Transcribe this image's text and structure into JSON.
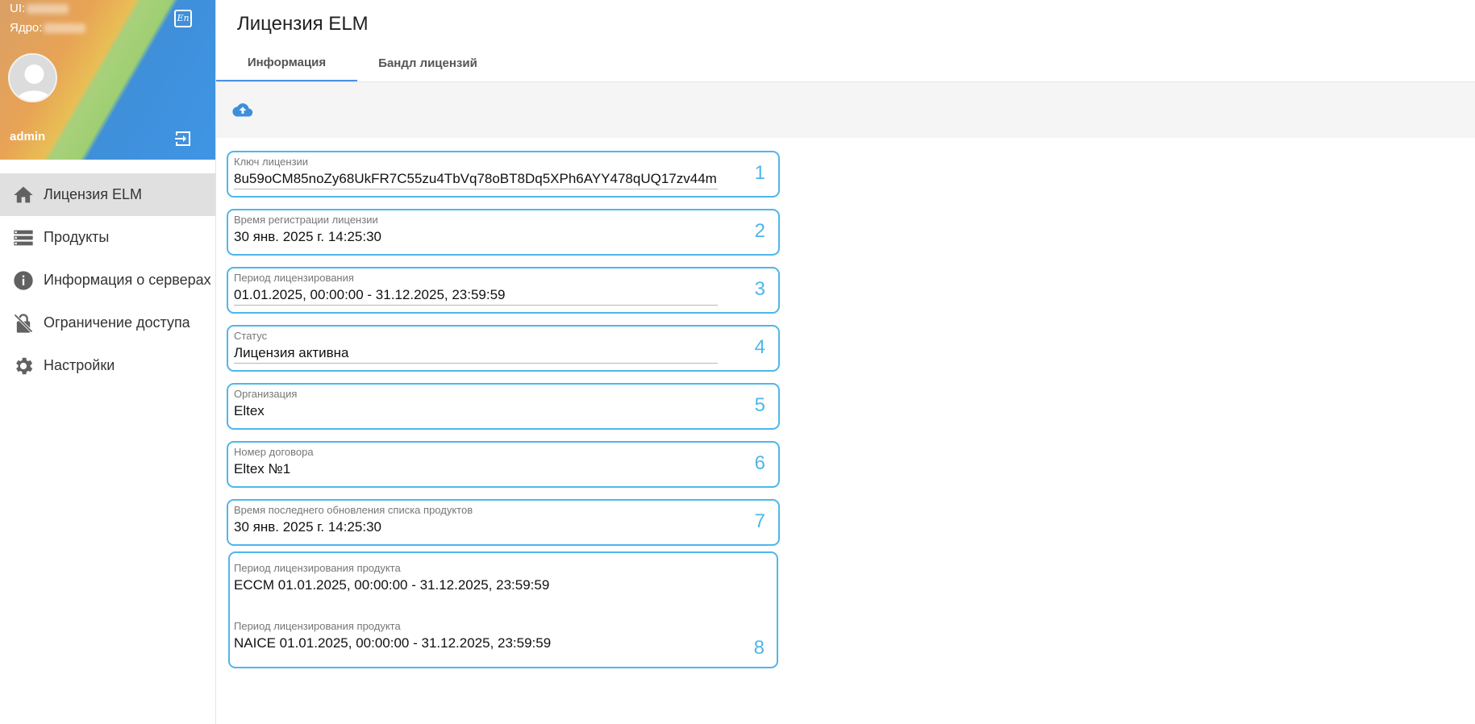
{
  "sidebar": {
    "ui_label": "UI:",
    "core_label": "Ядро:",
    "lang_icon_text": "En",
    "username": "admin",
    "items": [
      {
        "label": "Лицензия ELM",
        "icon": "home-icon",
        "active": true
      },
      {
        "label": "Продукты",
        "icon": "list-icon",
        "active": false
      },
      {
        "label": "Информация о серверах",
        "icon": "info-icon",
        "active": false
      },
      {
        "label": "Ограничение доступа",
        "icon": "lock-icon",
        "active": false
      },
      {
        "label": "Настройки",
        "icon": "gear-icon",
        "active": false
      }
    ]
  },
  "main": {
    "title": "Лицензия ELM",
    "tabs": [
      {
        "label": "Информация",
        "active": true
      },
      {
        "label": "Бандл лицензий",
        "active": false
      }
    ],
    "fields": [
      {
        "label": "Ключ лицензии",
        "value": "8u59oCM85noZy68UkFR7C55zu4TbVq78oBT8Dq5XPh6AYY478qUQ17zv44m",
        "num": "1"
      },
      {
        "label": "Время регистрации лицензии",
        "value": "30 янв. 2025 г. 14:25:30",
        "num": "2"
      },
      {
        "label": "Период лицензирования",
        "value": "01.01.2025, 00:00:00 - 31.12.2025, 23:59:59",
        "num": "3"
      },
      {
        "label": "Статус",
        "value": "Лицензия активна",
        "num": "4"
      },
      {
        "label": "Организация",
        "value": "Eltex",
        "num": "5"
      },
      {
        "label": "Номер договора",
        "value": "Eltex №1",
        "num": "6"
      },
      {
        "label": "Время последнего обновления списка продуктов",
        "value": "30 янв. 2025 г. 14:25:30",
        "num": "7"
      }
    ],
    "product_periods": {
      "num": "8",
      "items": [
        {
          "label": "Период лицензирования продукта",
          "value": "ECCM 01.01.2025, 00:00:00 - 31.12.2025, 23:59:59"
        },
        {
          "label": "Период лицензирования продукта",
          "value": "NAICE 01.01.2025, 00:00:00 - 31.12.2025, 23:59:59"
        }
      ]
    }
  },
  "colors": {
    "accent": "#4a90e2",
    "annotation": "#4fb6ea",
    "active_nav": "#e0e0e0"
  }
}
